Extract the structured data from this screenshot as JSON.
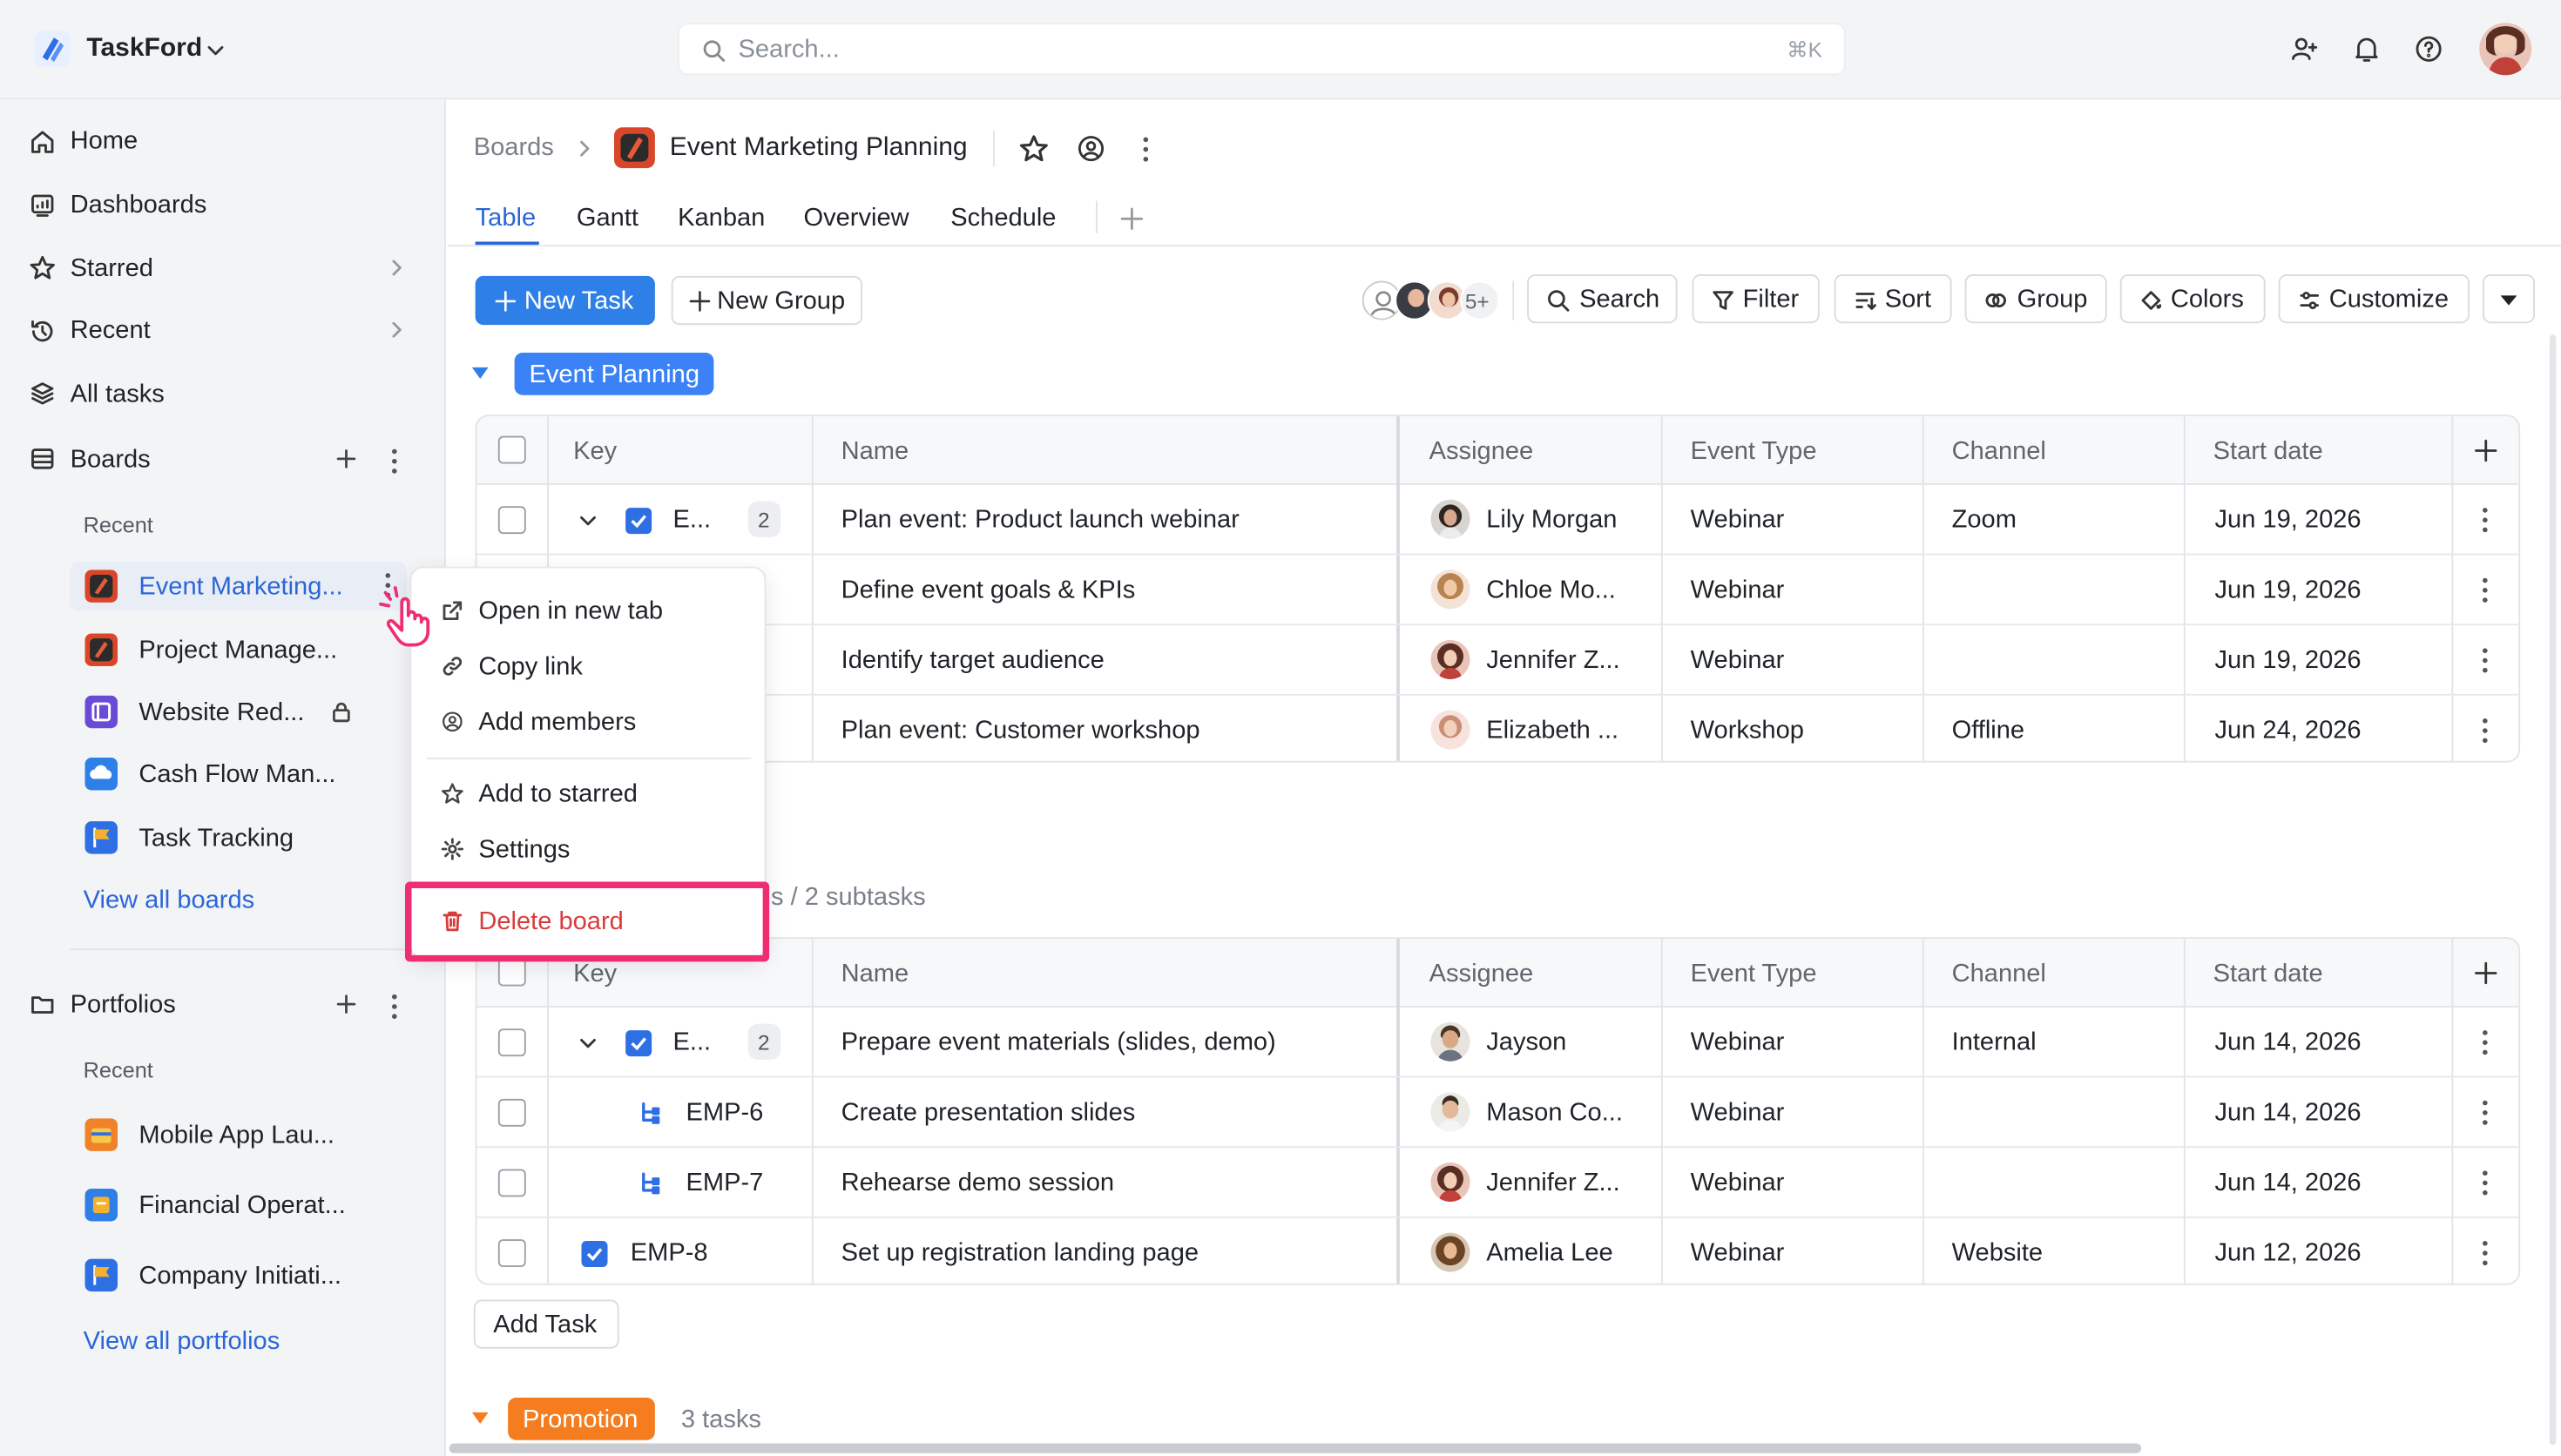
{
  "app": {
    "name": "TaskFord"
  },
  "search": {
    "placeholder": "Search...",
    "shortcut": "⌘K"
  },
  "sidebar": {
    "nav": [
      "Home",
      "Dashboards",
      "Starred",
      "Recent",
      "All tasks"
    ],
    "boards_label": "Boards",
    "recent_label": "Recent",
    "boards": [
      "Event Marketing...",
      "Project Manage...",
      "Website Red...",
      "Cash Flow Man...",
      "Task Tracking"
    ],
    "view_all_boards": "View all boards",
    "portfolios_label": "Portfolios",
    "portfolios_recent_label": "Recent",
    "portfolios": [
      "Mobile App Lau...",
      "Financial Operat...",
      "Company Initiati..."
    ],
    "view_all_portfolios": "View all portfolios"
  },
  "context_menu": {
    "items": [
      "Open in new tab",
      "Copy link",
      "Add members",
      "Add to starred",
      "Settings"
    ],
    "delete": "Delete board"
  },
  "breadcrumb": {
    "root": "Boards",
    "board": "Event Marketing Planning"
  },
  "tabs": [
    "Table",
    "Gantt",
    "Kanban",
    "Overview",
    "Schedule"
  ],
  "toolbar": {
    "new_task": "New Task",
    "new_group": "New Group",
    "members_more": "5+",
    "search": "Search",
    "filter": "Filter",
    "sort": "Sort",
    "group": "Group",
    "colors": "Colors",
    "customize": "Customize"
  },
  "columns": [
    "Key",
    "Name",
    "Assignee",
    "Event Type",
    "Channel",
    "Start date"
  ],
  "group1": {
    "name": "Event Planning",
    "color": "#3b82f6",
    "rows": [
      {
        "key": "E...",
        "count": "2",
        "name": "Plan event: Product launch webinar",
        "assignee": "Lily Morgan",
        "type": "Webinar",
        "channel": "Zoom",
        "date": "Jun 19, 2026"
      },
      {
        "key": "",
        "name": "Define event goals & KPIs",
        "assignee": "Chloe Mo...",
        "type": "Webinar",
        "channel": "",
        "date": "Jun 19, 2026"
      },
      {
        "key": "",
        "name": "Identify target audience",
        "assignee": "Jennifer Z...",
        "type": "Webinar",
        "channel": "",
        "date": "Jun 19, 2026"
      },
      {
        "key": "",
        "name": "Plan event: Customer workshop",
        "assignee": "Elizabeth ...",
        "type": "Workshop",
        "channel": "Offline",
        "date": "Jun 24, 2026"
      }
    ]
  },
  "group2": {
    "summary": "s / 2 subtasks",
    "rows": [
      {
        "key": "E...",
        "count": "2",
        "name": "Prepare event materials (slides, demo)",
        "assignee": "Jayson",
        "type": "Webinar",
        "channel": "Internal",
        "date": "Jun 14, 2026"
      },
      {
        "key": "EMP-6",
        "name": "Create presentation slides",
        "assignee": "Mason Co...",
        "type": "Webinar",
        "channel": "",
        "date": "Jun 14, 2026"
      },
      {
        "key": "EMP-7",
        "name": "Rehearse demo session",
        "assignee": "Jennifer Z...",
        "type": "Webinar",
        "channel": "",
        "date": "Jun 14, 2026"
      },
      {
        "key": "EMP-8",
        "name": "Set up registration landing page",
        "assignee": "Amelia Lee",
        "type": "Webinar",
        "channel": "Website",
        "date": "Jun 12, 2026"
      }
    ],
    "add_task": "Add Task"
  },
  "group3": {
    "name": "Promotion",
    "color": "#f57c1f",
    "count": "3 tasks"
  }
}
